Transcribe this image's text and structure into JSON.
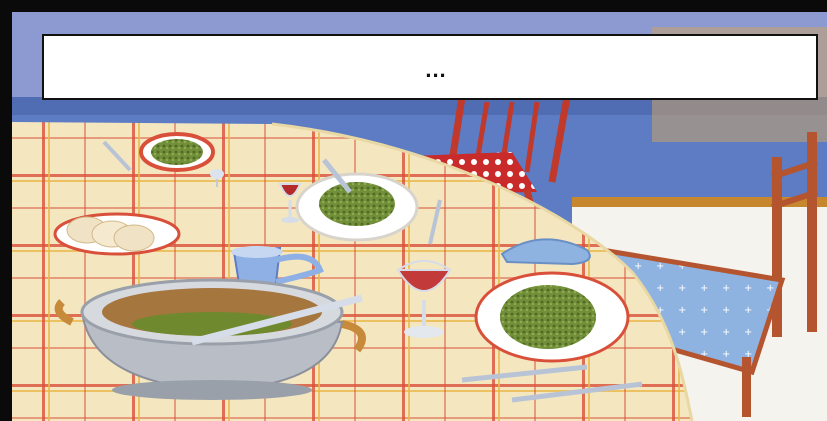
{
  "caption": {
    "text": "..."
  },
  "colors": {
    "frame": "#0a0a0a",
    "wall": "#8d9ad2",
    "floor": "#5d7cc4",
    "tablecloth": "#f4e7c0",
    "plaid_red": "#d9503a",
    "plaid_yellow": "#e8b84a",
    "food_green": "#6f8a2e",
    "chair_red": "#c0392b",
    "wine": "#b22a2a"
  },
  "icons": [
    "plate-icon",
    "fork-icon",
    "spoon-icon",
    "wine-glass-icon",
    "pitcher-icon",
    "soup-tureen-icon",
    "chair-icon",
    "bread-icon"
  ]
}
